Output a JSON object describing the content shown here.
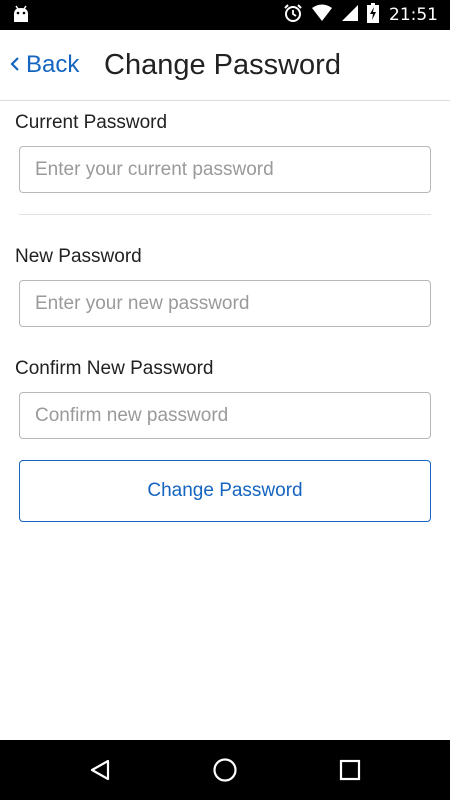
{
  "status_bar": {
    "time": "21:51",
    "icons": [
      "android-icon",
      "alarm-icon",
      "wifi-icon",
      "signal-icon",
      "battery-charging-icon"
    ]
  },
  "header": {
    "back_label": "Back",
    "title": "Change Password"
  },
  "form": {
    "current": {
      "label": "Current Password",
      "placeholder": "Enter your current password",
      "value": ""
    },
    "new": {
      "label": "New Password",
      "placeholder": "Enter your new password",
      "value": ""
    },
    "confirm": {
      "label": "Confirm New Password",
      "placeholder": "Confirm new password",
      "value": ""
    },
    "submit_label": "Change Password"
  },
  "nav_bar": {
    "buttons": [
      "back-nav-icon",
      "home-nav-icon",
      "recents-nav-icon"
    ]
  },
  "colors": {
    "accent": "#1565c0",
    "text": "#222222",
    "placeholder": "#9a9a9a",
    "border": "#b8b8b8"
  }
}
